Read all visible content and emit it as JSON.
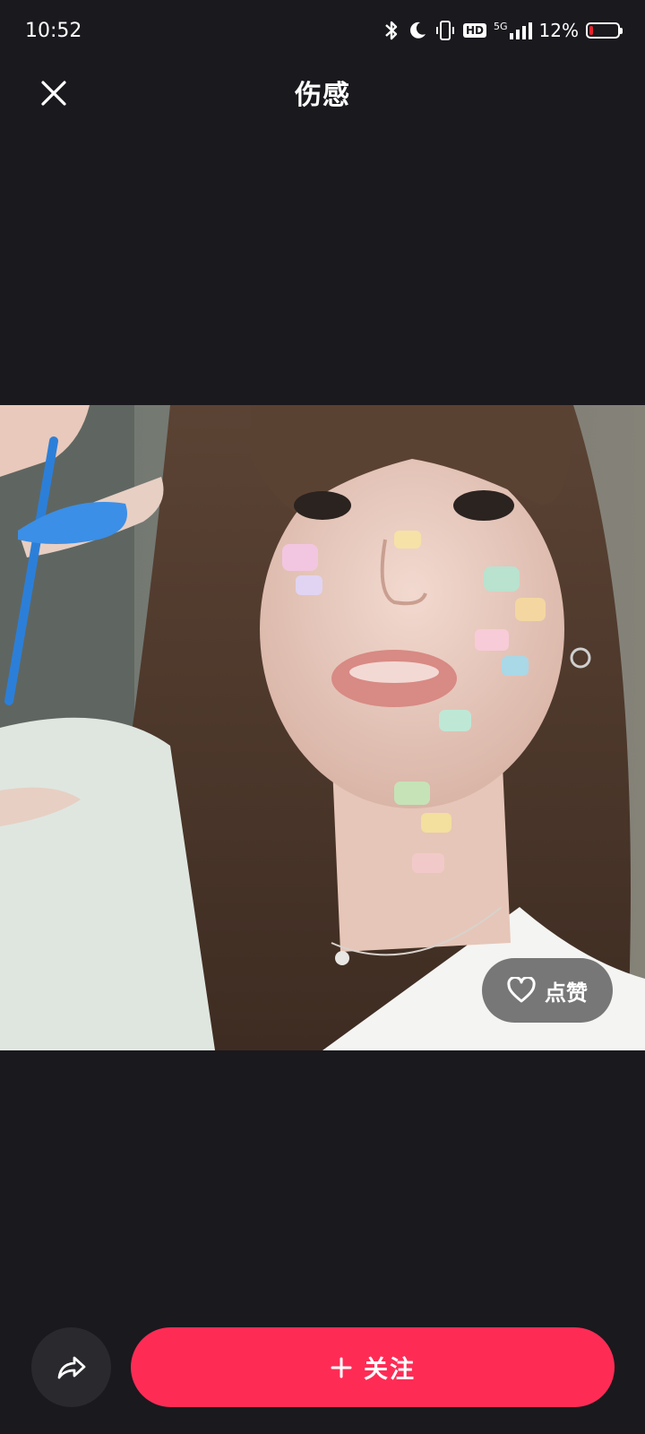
{
  "status_bar": {
    "time": "10:52",
    "network": "5G",
    "hd_label": "HD",
    "battery_percent": "12%",
    "battery_level": 0.12,
    "icons": [
      "bluetooth-icon",
      "moon-icon",
      "vibrate-icon",
      "hd-icon",
      "signal-icon",
      "battery-icon"
    ]
  },
  "header": {
    "title": "伤感",
    "close_icon": "close-icon"
  },
  "photo": {
    "like_label": "点赞",
    "like_icon": "heart-outline-icon"
  },
  "bottom_bar": {
    "share_icon": "share-arrow-icon",
    "follow_label": "关注",
    "follow_icon": "plus-icon"
  },
  "colors": {
    "background": "#1a191e",
    "accent": "#fe2c55",
    "battery_low": "#e5222b"
  }
}
